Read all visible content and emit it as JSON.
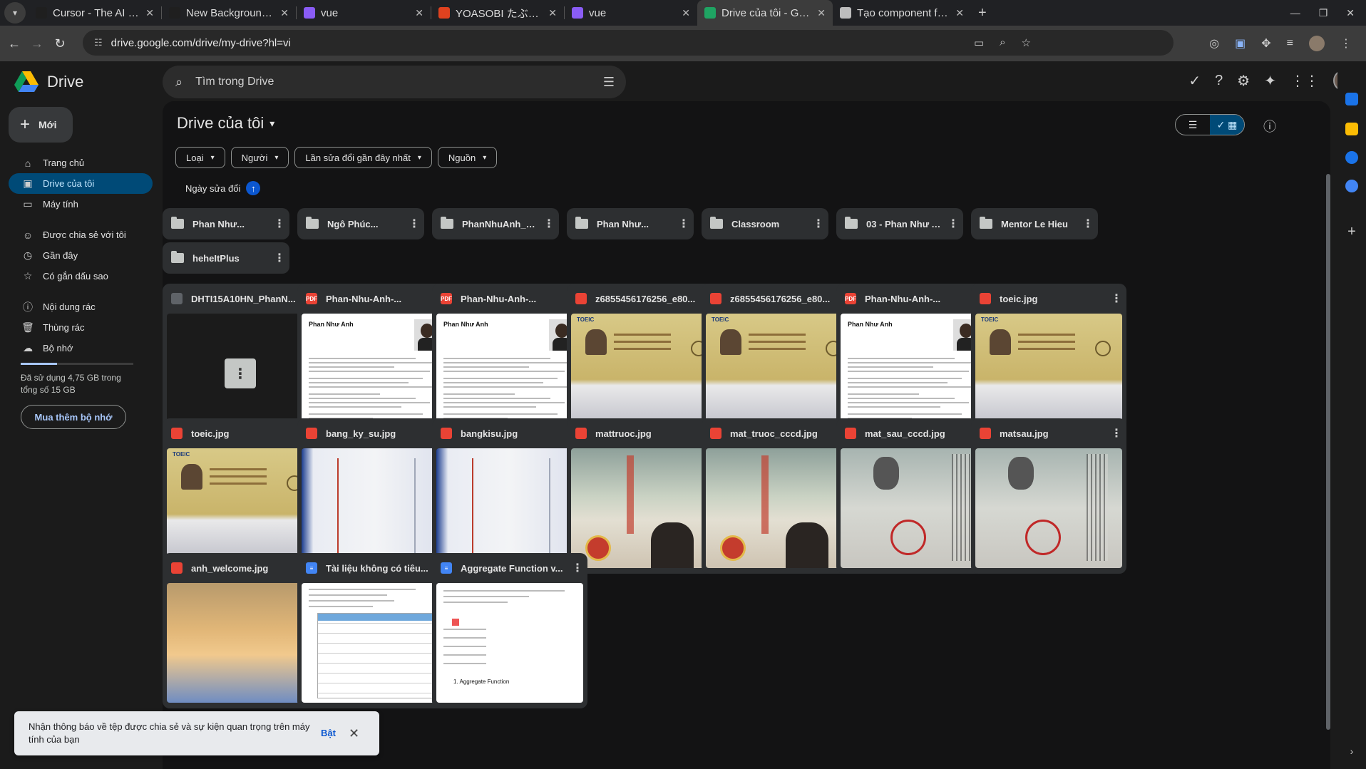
{
  "browser": {
    "tabs": [
      {
        "title": "Cursor - The AI Code Edit",
        "color": "#1f1f1f"
      },
      {
        "title": "New Background Agent -",
        "color": "#1f1f1f"
      },
      {
        "title": "vue",
        "color": "#8a5cf5"
      },
      {
        "title": "YOASOBI たぶん Prob",
        "color": "#e0421f"
      },
      {
        "title": "vue",
        "color": "#8a5cf5"
      },
      {
        "title": "Drive của tôi - Google Dr",
        "color": "#1fa463",
        "active": true
      },
      {
        "title": "Tạo component folder Vi",
        "color": "#bdbdbd"
      }
    ],
    "url": "drive.google.com/drive/my-drive?hl=vi"
  },
  "app": {
    "name": "Drive",
    "search_placeholder": "Tìm trong Drive",
    "new_label": "Mới"
  },
  "sidebar": {
    "items": [
      {
        "label": "Trang chủ",
        "icon": "home-icon"
      },
      {
        "label": "Drive của tôi",
        "icon": "drive-icon",
        "active": true
      },
      {
        "label": "Máy tính",
        "icon": "computer-icon"
      },
      {
        "label": "Được chia sẻ với tôi",
        "icon": "shared-icon"
      },
      {
        "label": "Gần đây",
        "icon": "clock-icon"
      },
      {
        "label": "Có gắn dấu sao",
        "icon": "star-icon"
      },
      {
        "label": "Nội dung rác",
        "icon": "spam-icon"
      },
      {
        "label": "Thùng rác",
        "icon": "trash-icon"
      },
      {
        "label": "Bộ nhớ",
        "icon": "cloud-icon"
      }
    ],
    "storage_text": "Đã sử dụng 4,75 GB trong tổng số 15 GB",
    "storage_fraction": 0.32,
    "buy_label": "Mua thêm bộ nhớ"
  },
  "main": {
    "title": "Drive của tôi",
    "filters": [
      "Loại",
      "Người",
      "Lần sửa đổi gần đây nhất",
      "Nguồn"
    ],
    "sort_label": "Ngày sửa đổi",
    "folders": [
      "Phan Như...",
      "Ngô Phúc...",
      "PhanNhuAnh_DHTI15...",
      "Phan Như...",
      "Classroom",
      "03 - Phan Như Anh -...",
      "Mentor Le Hieu",
      "heheItPlus"
    ],
    "files": [
      {
        "name": "DHTI15A10HN_PhanN...",
        "type": "zip",
        "thumb": "dark"
      },
      {
        "name": "Phan-Nhu-Anh-...",
        "type": "pdf",
        "thumb": "cv"
      },
      {
        "name": "Phan-Nhu-Anh-...",
        "type": "pdf",
        "thumb": "cv"
      },
      {
        "name": "z6855456176256_e80...",
        "type": "image",
        "thumb": "toeic"
      },
      {
        "name": "z6855456176256_e80...",
        "type": "image",
        "thumb": "toeic"
      },
      {
        "name": "Phan-Nhu-Anh-...",
        "type": "pdf",
        "thumb": "cv"
      },
      {
        "name": "toeic.jpg",
        "type": "image",
        "thumb": "toeic"
      },
      {
        "name": "toeic.jpg",
        "type": "image",
        "thumb": "toeic"
      },
      {
        "name": "bang_ky_su.jpg",
        "type": "image",
        "thumb": "degree"
      },
      {
        "name": "bangkisu.jpg",
        "type": "image",
        "thumb": "degree"
      },
      {
        "name": "mattruoc.jpg",
        "type": "image",
        "thumb": "id"
      },
      {
        "name": "mat_truoc_cccd.jpg",
        "type": "image",
        "thumb": "id"
      },
      {
        "name": "mat_sau_cccd.jpg",
        "type": "image",
        "thumb": "back"
      },
      {
        "name": "matsau.jpg",
        "type": "image",
        "thumb": "back"
      },
      {
        "name": "anh_welcome.jpg",
        "type": "image",
        "thumb": "sky"
      },
      {
        "name": "Tài liệu không có tiêu...",
        "type": "doc",
        "thumb": "doc"
      },
      {
        "name": "Aggregate Function v...",
        "type": "doc",
        "thumb": "doc2"
      }
    ],
    "cv_name": "Phan Như Anh",
    "toeic_label": "TOEIC",
    "doc_footer": "1. Aggregate Function"
  },
  "toast": {
    "message": "Nhận thông báo về tệp được chia sẻ và sự kiện quan trọng trên máy tính của bạn",
    "action": "Bật"
  },
  "colors": {
    "pdf": "#ea4335",
    "image": "#ea4335",
    "doc": "#4285f4",
    "zip": "#5f6368"
  }
}
